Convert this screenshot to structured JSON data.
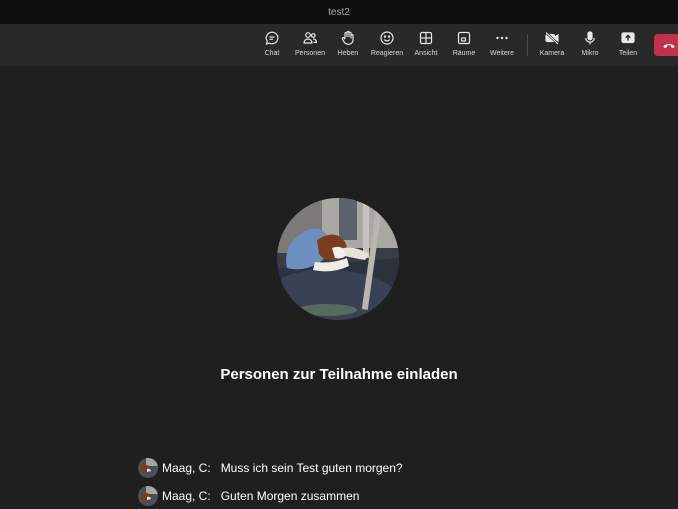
{
  "window": {
    "title": "test2"
  },
  "toolbar": {
    "chat": "Chat",
    "people": "Personen",
    "raise": "Heben",
    "react": "Reagieren",
    "view": "Ansicht",
    "rooms": "Räume",
    "more": "Weitere",
    "camera": "Kamera",
    "mic": "Mikro",
    "share": "Teilen"
  },
  "stage": {
    "invite_text": "Personen zur Teilnahme einladen"
  },
  "chat": {
    "messages": [
      {
        "author": "Maag, C:",
        "text": "Muss ich sein Test guten morgen?"
      },
      {
        "author": "Maag, C:",
        "text": "Guten Morgen zusammen"
      }
    ]
  },
  "colors": {
    "leave": "#c4314b",
    "background": "#1f1f1f",
    "toolbar": "#292929"
  }
}
